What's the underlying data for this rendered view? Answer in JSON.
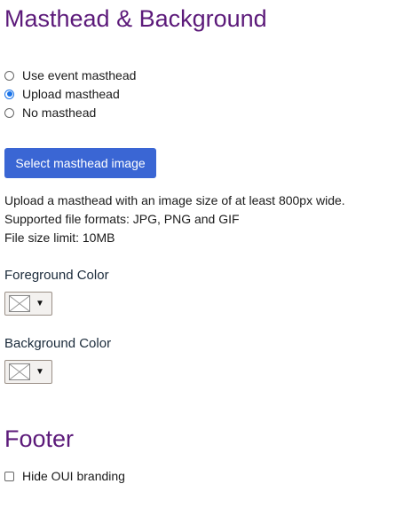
{
  "masthead": {
    "title": "Masthead & Background",
    "options": [
      {
        "label": "Use event masthead",
        "checked": false
      },
      {
        "label": "Upload masthead",
        "checked": true
      },
      {
        "label": "No masthead",
        "checked": false
      }
    ],
    "select_button": "Select masthead image",
    "info": [
      "Upload a masthead with an image size of at least 800px wide.",
      "Supported file formats: JPG, PNG and GIF",
      "File size limit: 10MB"
    ],
    "foreground_label": "Foreground Color",
    "background_label": "Background Color",
    "caret_glyph": "▼"
  },
  "footer": {
    "title": "Footer",
    "hide_branding_label": "Hide OUI branding",
    "hide_branding_checked": false
  }
}
